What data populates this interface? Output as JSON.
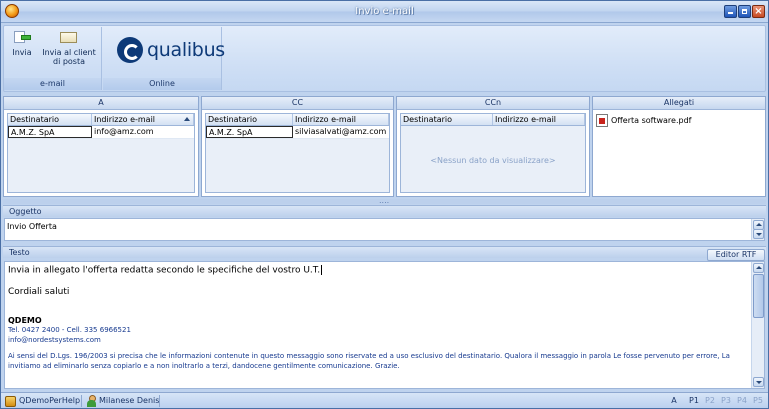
{
  "window": {
    "title": "Invio e-mail"
  },
  "ribbon": {
    "groups": [
      {
        "label": "e-mail",
        "buttons": [
          {
            "label": "Invia"
          },
          {
            "label": "Invia al client di posta"
          }
        ]
      },
      {
        "label": "Online",
        "logo_text": "qualibus"
      }
    ]
  },
  "recipients": {
    "to": {
      "header": "A",
      "columns": [
        "Destinatario",
        "Indirizzo e-mail"
      ],
      "rows": [
        [
          "A.M.Z. SpA",
          "info@amz.com"
        ]
      ]
    },
    "cc": {
      "header": "CC",
      "columns": [
        "Destinatario",
        "Indirizzo e-mail"
      ],
      "rows": [
        [
          "A.M.Z. SpA",
          "silviasalvati@amz.com"
        ]
      ]
    },
    "bcc": {
      "header": "CCn",
      "columns": [
        "Destinatario",
        "Indirizzo e-mail"
      ],
      "empty_text": "<Nessun dato da visualizzare>"
    },
    "attachments": {
      "header": "Allegati",
      "items": [
        "Offerta software.pdf"
      ]
    }
  },
  "subject": {
    "label": "Oggetto",
    "value": "Invio Offerta"
  },
  "body": {
    "label": "Testo",
    "editor_button": "Editor RTF",
    "line1": "Invia in allegato l'offerta redatta secondo le specifiche del vostro U.T.",
    "line2": "Cordiali saluti",
    "company": "QDEMO",
    "phone": "Tel. 0427 2400 - Cell. 335 6966521",
    "email": "info@nordestsystems.com",
    "disclaimer": "Ai sensi del D.Lgs. 196/2003 si precisa che le informazioni contenute in questo messaggio sono riservate ed a uso esclusivo del destinatario. Qualora il messaggio in parola Le fosse pervenuto per errore, La invitiamo ad eliminarlo senza copiarlo e a non inoltrarlo a terzi, dandocene gentilmente comunicazione. Grazie."
  },
  "statusbar": {
    "database": "QDemoPerHelp",
    "user": "Milanese Denis",
    "mode": "A",
    "pages": [
      "P1",
      "P2",
      "P3",
      "P4",
      "P5"
    ],
    "active_page": "P1"
  },
  "colors": {
    "accent": "#0e3a78",
    "frame": "#bfd3ee"
  }
}
